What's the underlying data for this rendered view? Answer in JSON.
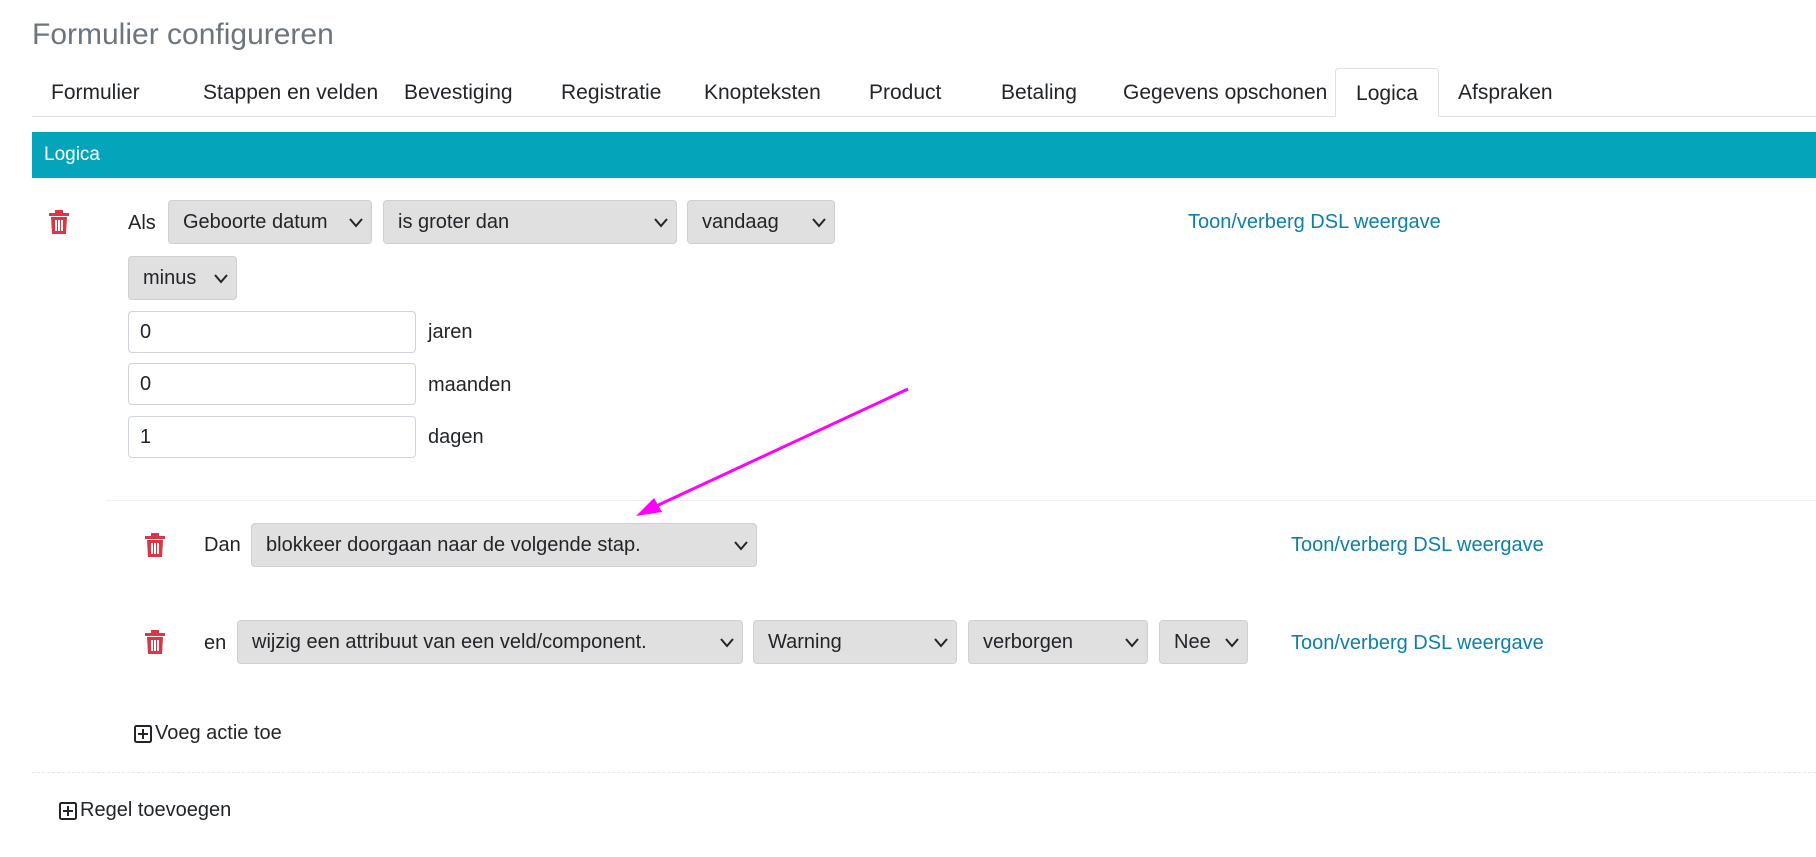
{
  "page": {
    "title": "Formulier configureren"
  },
  "tabs": [
    {
      "label": "Formulier"
    },
    {
      "label": "Stappen en velden"
    },
    {
      "label": "Bevestiging"
    },
    {
      "label": "Registratie"
    },
    {
      "label": "Knopteksten"
    },
    {
      "label": "Product"
    },
    {
      "label": "Betaling"
    },
    {
      "label": "Gegevens opschonen"
    },
    {
      "label": "Logica",
      "active": true
    },
    {
      "label": "Afspraken"
    }
  ],
  "section": {
    "header": "Logica"
  },
  "rule": {
    "trigger_label": "Als",
    "field_select": "Geboorte datum",
    "operator_select": "is groter dan",
    "compare_select": "vandaag",
    "modifier_select": "minus",
    "offsets": [
      {
        "value": "0",
        "unit": "jaren"
      },
      {
        "value": "0",
        "unit": "maanden"
      },
      {
        "value": "1",
        "unit": "dagen"
      }
    ],
    "dsl_link": "Toon/verberg DSL weergave",
    "actions": [
      {
        "prefix": "Dan",
        "action_select": "blokkeer doorgaan naar de volgende stap.",
        "dsl_link": "Toon/verberg DSL weergave"
      },
      {
        "prefix": "en",
        "action_select": "wijzig een attribuut van een veld/component.",
        "component_select": "Warning",
        "attribute_select": "verborgen",
        "value_select": "Nee",
        "dsl_link": "Toon/verberg DSL weergave"
      }
    ],
    "add_action": "Voeg actie toe"
  },
  "add_rule": "Regel toevoegen",
  "colors": {
    "accent": "#04a5bb",
    "link": "#0e7fa8",
    "delete": "#dc3545",
    "annotation_arrow": "#ff00ff"
  },
  "icons": {
    "delete": "trash-icon",
    "add": "plus-square-icon",
    "dropdown": "chevron-down-icon"
  }
}
